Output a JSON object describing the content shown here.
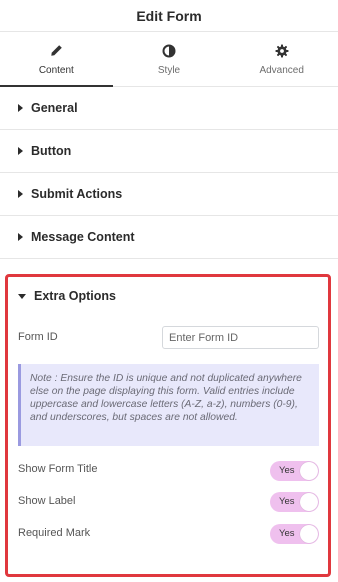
{
  "header": {
    "title": "Edit Form"
  },
  "tabs": [
    {
      "label": "Content",
      "icon": "pencil-icon",
      "active": true
    },
    {
      "label": "Style",
      "icon": "half-circle-icon",
      "active": false
    },
    {
      "label": "Advanced",
      "icon": "gear-icon",
      "active": false
    }
  ],
  "sections": [
    {
      "label": "General"
    },
    {
      "label": "Button"
    },
    {
      "label": "Submit Actions"
    },
    {
      "label": "Message Content"
    }
  ],
  "extra_options": {
    "title": "Extra Options",
    "form_id": {
      "label": "Form ID",
      "value": "",
      "placeholder": "Enter Form ID"
    },
    "note": "Note : Ensure the ID is unique and not duplicated anywhere else on the page displaying this form. Valid entries include uppercase and lowercase letters (A-Z, a-z), numbers (0-9), and underscores, but spaces are not allowed.",
    "toggles": [
      {
        "label": "Show Form Title",
        "value": "Yes",
        "enabled": true
      },
      {
        "label": "Show Label",
        "value": "Yes",
        "enabled": true
      },
      {
        "label": "Required Mark",
        "value": "Yes",
        "enabled": true
      }
    ]
  },
  "colors": {
    "highlight": "#e0383e",
    "toggle_bg": "#efc0ee",
    "note_bg": "#e8e8fb",
    "note_border": "#9a9ae0"
  }
}
